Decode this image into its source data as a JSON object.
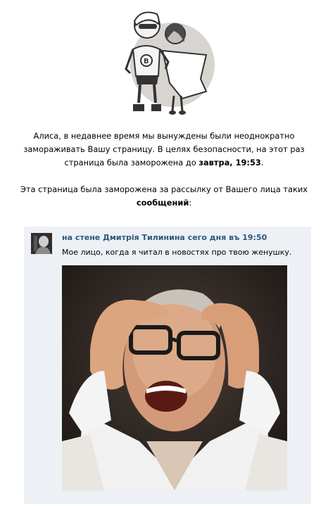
{
  "notice": {
    "line1": "Алиса, в недавнее время мы вынуждены были неоднократно",
    "line2": "замораживать Вашу страницу. В целях безопасности, на этот раз",
    "line3_pre": "страница была заморожена до ",
    "line3_bold": "завтра, 19:53",
    "line3_post": ".",
    "reason_line1": "Эта страница была заморожена за рассылку от Вашего лица таких",
    "reason_bold": "сообщений",
    "reason_post": ":"
  },
  "post": {
    "header_prefix": "на стене",
    "header_owner": "Дмитрія Тилинина",
    "header_time": "сего дня въ 19:50",
    "text": "Мое лицо, когда я читал в новостях про твою женушку."
  },
  "colors": {
    "link": "#2b587a",
    "post_bg": "#edf1f5"
  }
}
